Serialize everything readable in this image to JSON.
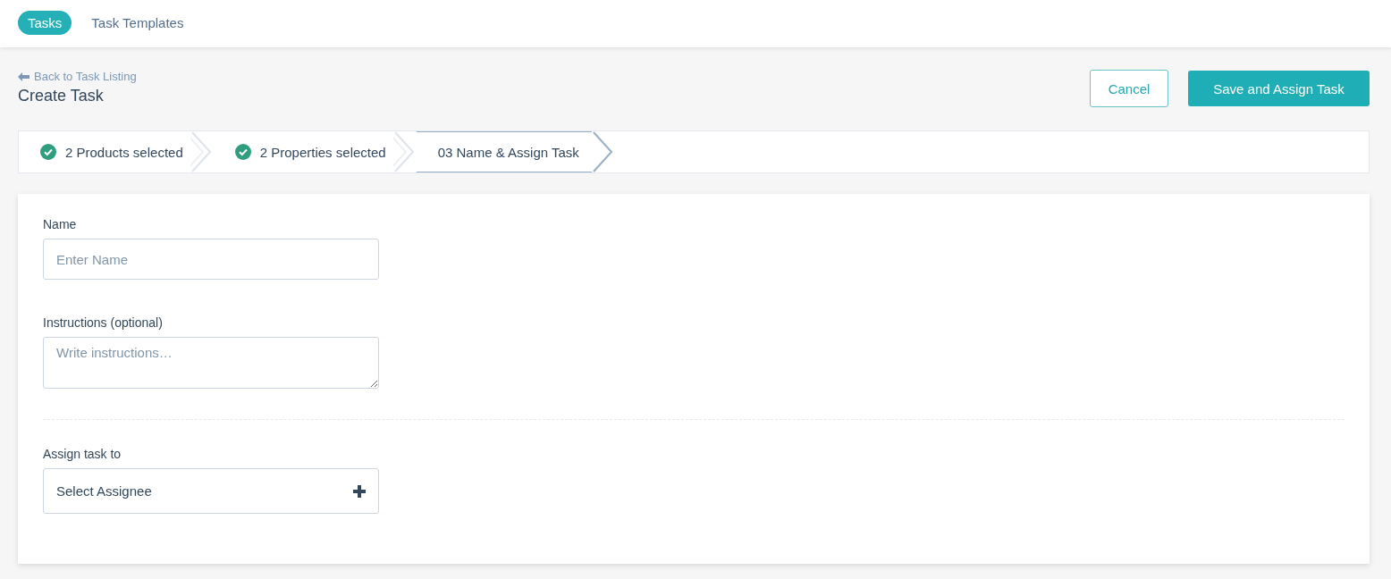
{
  "nav_tabs": [
    {
      "label": "Tasks",
      "selected": true
    },
    {
      "label": "Task Templates",
      "selected": false
    }
  ],
  "back_link": "Back to Task Listing",
  "page_title": "Create Task",
  "buttons": {
    "cancel": "Cancel",
    "primary": "Save and Assign Task"
  },
  "steps": [
    {
      "label": "2 Products selected",
      "completed": true,
      "selected": false
    },
    {
      "label": "2 Properties selected",
      "completed": true,
      "selected": false
    },
    {
      "label": "03 Name & Assign Task",
      "completed": false,
      "selected": true
    }
  ],
  "form": {
    "name_label": "Name",
    "name_placeholder": "Enter Name",
    "instructions_label": "Instructions (optional)",
    "instructions_placeholder": "Write instructions…",
    "assign_label": "Assign task to",
    "assign_value": "Select Assignee"
  }
}
